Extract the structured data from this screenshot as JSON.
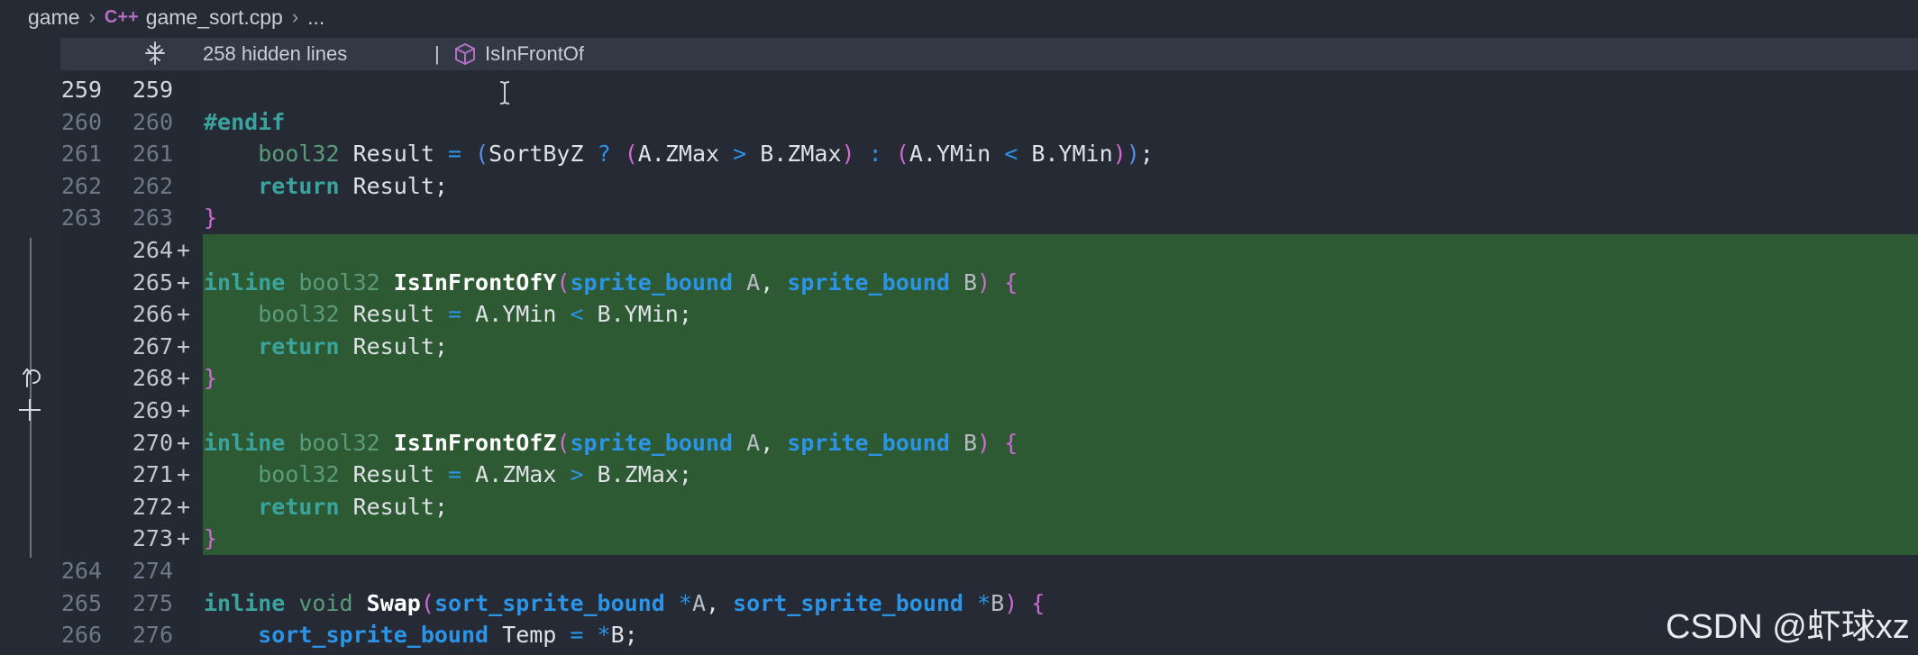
{
  "breadcrumb": {
    "root": "game",
    "file_icon": "C++",
    "file": "game_sort.cpp",
    "more": "..."
  },
  "hidden_bar": {
    "text": "258 hidden lines",
    "separator": "|",
    "symbol": "IsInFrontOf",
    "icons": [
      "unfold-icon",
      "cube-icon"
    ]
  },
  "lines": [
    {
      "old": "259",
      "new": "259",
      "added": false,
      "current": true,
      "code": ""
    },
    {
      "old": "260",
      "new": "260",
      "added": false,
      "code": "#endif"
    },
    {
      "old": "261",
      "new": "261",
      "added": false,
      "code": "    bool32 Result = (SortByZ ? (A.ZMax > B.ZMax) : (A.YMin < B.YMin));"
    },
    {
      "old": "262",
      "new": "262",
      "added": false,
      "code": "    return Result;"
    },
    {
      "old": "263",
      "new": "263",
      "added": false,
      "code": "}"
    },
    {
      "old": "",
      "new": "264",
      "added": true,
      "code": ""
    },
    {
      "old": "",
      "new": "265",
      "added": true,
      "code": "inline bool32 IsInFrontOfY(sprite_bound A, sprite_bound B) {"
    },
    {
      "old": "",
      "new": "266",
      "added": true,
      "code": "    bool32 Result = A.YMin < B.YMin;"
    },
    {
      "old": "",
      "new": "267",
      "added": true,
      "code": "    return Result;"
    },
    {
      "old": "",
      "new": "268",
      "added": true,
      "code": "}"
    },
    {
      "old": "",
      "new": "269",
      "added": true,
      "code": ""
    },
    {
      "old": "",
      "new": "270",
      "added": true,
      "code": "inline bool32 IsInFrontOfZ(sprite_bound A, sprite_bound B) {"
    },
    {
      "old": "",
      "new": "271",
      "added": true,
      "code": "    bool32 Result = A.ZMax > B.ZMax;"
    },
    {
      "old": "",
      "new": "272",
      "added": true,
      "code": "    return Result;"
    },
    {
      "old": "",
      "new": "273",
      "added": true,
      "code": "}"
    },
    {
      "old": "264",
      "new": "274",
      "added": false,
      "code": ""
    },
    {
      "old": "265",
      "new": "275",
      "added": false,
      "code": "inline void Swap(sort_sprite_bound *A, sort_sprite_bound *B) {"
    },
    {
      "old": "266",
      "new": "276",
      "added": false,
      "code": "    sort_sprite_bound Temp = *B;"
    }
  ],
  "added_marker": "+",
  "watermark": "CSDN @虾球xz",
  "colors": {
    "background": "#252a34",
    "added_line": "#2e5a33",
    "keyword": "#3aa39e",
    "type_struct": "#2b94e6",
    "function": "#ffffff"
  }
}
